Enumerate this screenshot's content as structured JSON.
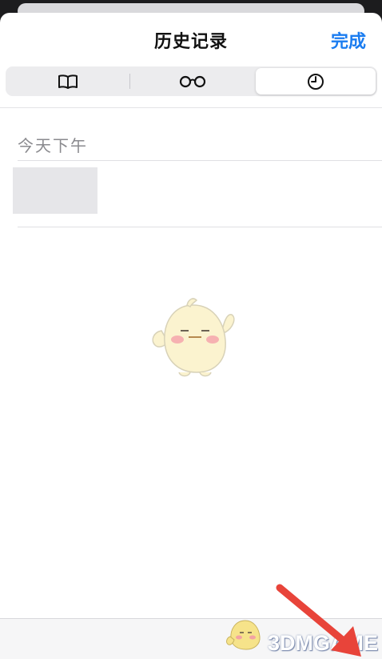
{
  "header": {
    "title": "历史记录",
    "done_label": "完成"
  },
  "segments": [
    {
      "icon": "book-icon",
      "selected": false
    },
    {
      "icon": "glasses-icon",
      "selected": false
    },
    {
      "icon": "clock-icon",
      "selected": true
    }
  ],
  "history": {
    "section_label": "今天下午",
    "items": [
      {
        "thumbnail": "blank"
      }
    ]
  },
  "watermark": {
    "text": "3DMGAME"
  },
  "colors": {
    "accent": "#1a7cf0",
    "annotation_arrow": "#e8443a"
  }
}
